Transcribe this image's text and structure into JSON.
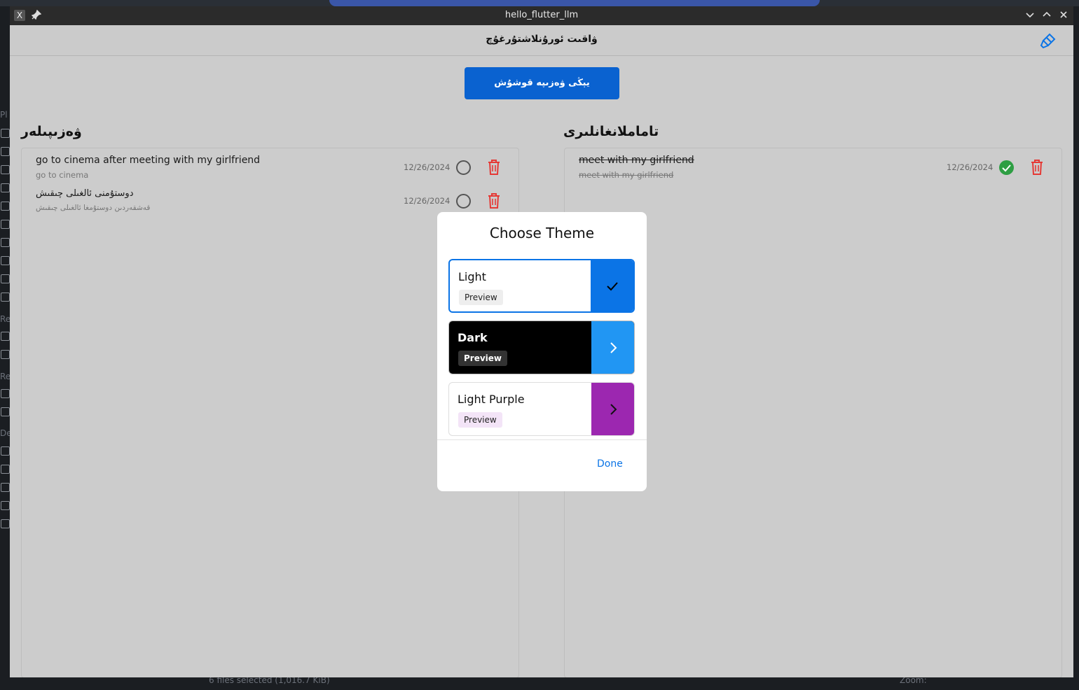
{
  "window": {
    "title": "hello_flutter_llm"
  },
  "appbar": {
    "title": "ۋاقىت ئورۇنلاشتۇرغۇچ"
  },
  "main_button": {
    "label": "يېڭى ۋەزىپە قوشۇش"
  },
  "pending": {
    "title": "ۋەزىپىلەر",
    "tasks": [
      {
        "title": "go to cinema after meeting with my girlfriend",
        "subtitle": "go to cinema",
        "date": "12/26/2024"
      },
      {
        "title": "دوستۇمنى ئالغىلى چىقىش",
        "subtitle": "قەشقەردىن دوستۇمغا ئالغىلى چىقىش",
        "date": "12/26/2024"
      }
    ]
  },
  "completed": {
    "title": "تاماملانغانلىرى",
    "tasks": [
      {
        "title": "meet with my girlfriend",
        "subtitle": "meet with my girlfriend",
        "date": "12/26/2024"
      }
    ]
  },
  "dialog": {
    "title": "Choose Theme",
    "options": [
      {
        "name": "Light",
        "preview": "Preview",
        "selected": true,
        "color": "#0b74e6"
      },
      {
        "name": "Dark",
        "preview": "Preview",
        "selected": false,
        "color": "#2196f3"
      },
      {
        "name": "Light Purple",
        "preview": "Preview",
        "selected": false,
        "color": "#9c27b0"
      }
    ],
    "done_label": "Done"
  },
  "desktop": {
    "status_left": "6 files selected (1,016.7 KiB)",
    "status_right": "Zoom:"
  }
}
